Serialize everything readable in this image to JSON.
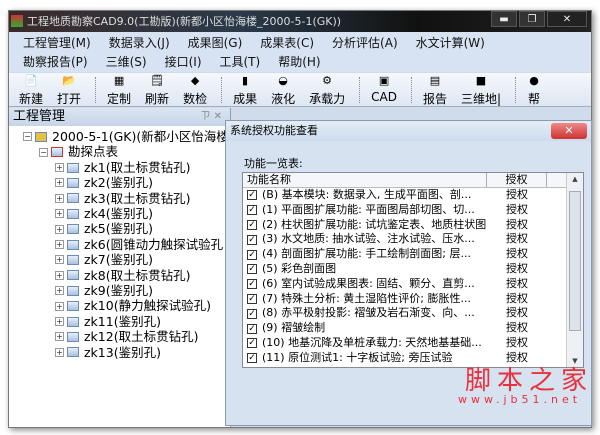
{
  "window": {
    "title": "工程地质勘察CAD9.0(工勘版)(新都小区怡海楼_2000-5-1(GK))",
    "min": "▬",
    "max": "❐",
    "close": "✕"
  },
  "menu": {
    "row1": [
      "工程管理(M)",
      "数据录入(J)",
      "成果图(G)",
      "成果表(C)",
      "分析评估(A)",
      "水文计算(W)"
    ],
    "row2": [
      "勘察报告(P)",
      "三维(S)",
      "接口(I)",
      "工具(T)",
      "帮助(H)"
    ]
  },
  "toolbar": [
    {
      "label": "新建",
      "icon": "📄"
    },
    {
      "label": "打开",
      "icon": "📂"
    },
    {
      "label": "定制",
      "icon": "▦"
    },
    {
      "label": "刷新",
      "icon": "🗒"
    },
    {
      "label": "数检",
      "icon": "◆"
    },
    {
      "label": "成果",
      "icon": "▮"
    },
    {
      "label": "液化",
      "icon": "◒"
    },
    {
      "label": "承载力",
      "icon": "⚙"
    },
    {
      "label": "CAD",
      "icon": "▣"
    },
    {
      "label": "报告",
      "icon": "▤"
    },
    {
      "label": "三维地|",
      "icon": "■"
    },
    {
      "label": "帮",
      "icon": "●"
    }
  ],
  "pane": {
    "title": "工程管理",
    "pin": "ㄗ ✕",
    "root": "2000-5-1(GK)(新都小区怡海楼",
    "group": "勘探点表",
    "items": [
      "zk1(取土标贯钻孔)",
      "zk2(鉴别孔)",
      "zk3(取土标贯钻孔)",
      "zk4(鉴别孔)",
      "zk5(鉴别孔)",
      "zk6(圆锥动力触探试验孔",
      "zk7(鉴别孔)",
      "zk8(取土标贯钻孔)",
      "zk9(鉴别孔)",
      "zk10(静力触探试验孔)",
      "zk11(鉴别孔)",
      "zk12(取土标贯钻孔)",
      "zk13(鉴别孔)"
    ]
  },
  "dialog": {
    "title": "系统授权功能查看",
    "close": "✕",
    "list_label": "功能一览表:",
    "headers": [
      "功能名称",
      "授权"
    ],
    "rows": [
      {
        "name": "(B) 基本模块: 数据录入, 生成平面图、剖...",
        "auth": "授权"
      },
      {
        "name": "(1) 平面图扩展功能: 平面图局部切图、切...",
        "auth": "授权"
      },
      {
        "name": "(2) 柱状图扩展功能: 试坑鉴定表、地质柱状图",
        "auth": "授权"
      },
      {
        "name": "(3) 水文地质: 抽水试验、注水试验、压水...",
        "auth": "授权"
      },
      {
        "name": "(4) 剖面图扩展功能: 手工绘制剖面图; 层...",
        "auth": "授权"
      },
      {
        "name": "(5) 彩色剖面图",
        "auth": "授权"
      },
      {
        "name": "(6) 室内试验成果图表: 固结、颗分、直剪...",
        "auth": "授权"
      },
      {
        "name": "(7) 特殊土分析: 黄土湿陷性评价; 膨胀性...",
        "auth": "授权"
      },
      {
        "name": "(8) 赤平极射投影: 褶皱及岩石渐变、向、...",
        "auth": "授权"
      },
      {
        "name": "(9) 褶皱绘制",
        "auth": "授权"
      },
      {
        "name": "(10) 地基沉降及单桩承载力: 天然地基基础...",
        "auth": "授权"
      },
      {
        "name": "(11) 原位测试1: 十字板试验; 旁压试验",
        "auth": "授权"
      }
    ]
  },
  "watermark": {
    "text": "脚本之家",
    "url": "www.jb51.net"
  }
}
